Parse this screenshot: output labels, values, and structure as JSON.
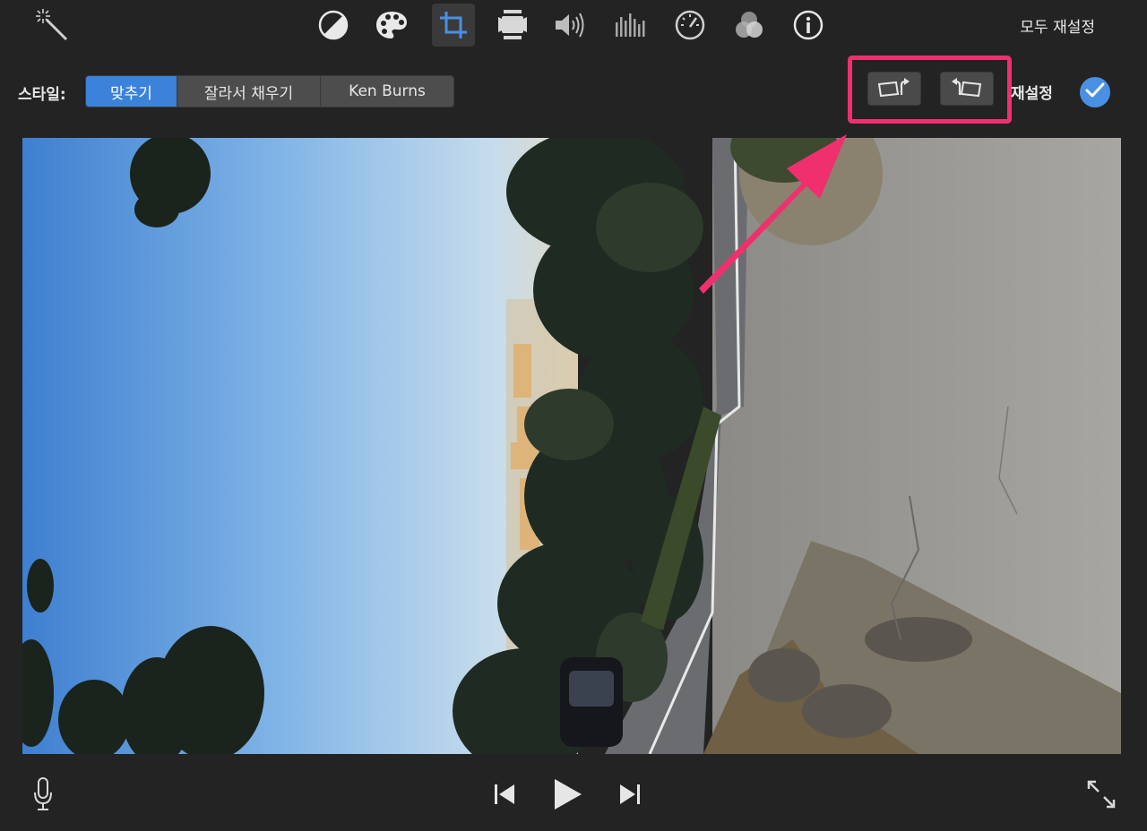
{
  "toolbar": {
    "icons": [
      {
        "name": "magic-wand-icon"
      },
      {
        "name": "color-balance-icon"
      },
      {
        "name": "color-palette-icon"
      },
      {
        "name": "crop-icon",
        "active": true
      },
      {
        "name": "stabilization-camera-icon"
      },
      {
        "name": "volume-icon"
      },
      {
        "name": "equalizer-icon"
      },
      {
        "name": "speed-icon"
      },
      {
        "name": "clip-filter-icon"
      },
      {
        "name": "info-icon"
      }
    ],
    "reset_all": "모두 재설정"
  },
  "style_row": {
    "label": "스타일:",
    "options": [
      "맞추기",
      "잘라서 채우기",
      "Ken Burns"
    ],
    "selected": "맞추기",
    "rotate_left": "rotate-counterclockwise-icon",
    "rotate_right": "rotate-clockwise-icon",
    "reset": "재설정",
    "apply": "checkmark-icon"
  },
  "colors": {
    "background": "#232323",
    "accent": "#3b82db",
    "highlight": "#f0306e",
    "check": "#4a90e2"
  },
  "viewer": {
    "content": "rotated-video-frame"
  },
  "playback": {
    "mic": "microphone-icon",
    "prev": "skip-back-icon",
    "play": "play-icon",
    "next": "skip-forward-icon",
    "fullscreen": "fullscreen-icon"
  }
}
